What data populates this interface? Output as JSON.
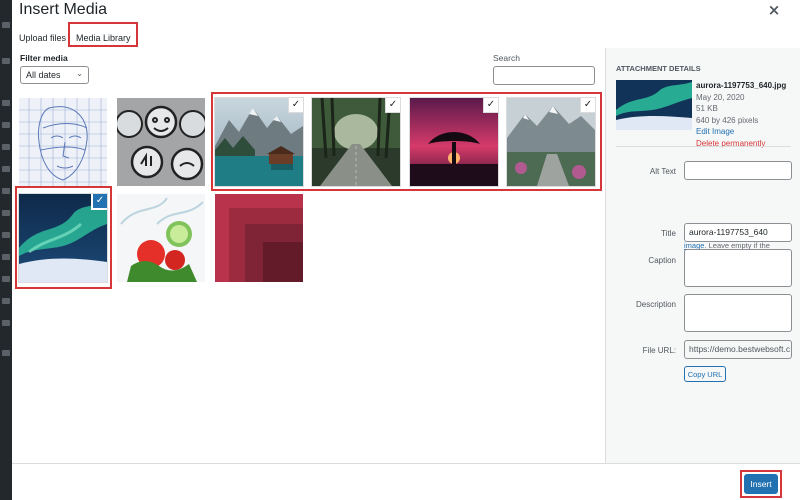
{
  "modal": {
    "title": "Insert Media",
    "close_glyph": "×",
    "tabs": [
      {
        "label": "Upload files"
      },
      {
        "label": "Media Library"
      }
    ]
  },
  "filter": {
    "label": "Filter media",
    "value": "All dates",
    "chevron_icon": "chevron-down-icon"
  },
  "search": {
    "label": "Search",
    "value": "",
    "placeholder": ""
  },
  "grid": {
    "check_glyph": "✓",
    "items": [
      {
        "name": "wireframe-face",
        "selected": false
      },
      {
        "name": "metal-face-buttons",
        "selected": false
      },
      {
        "name": "mountain-lake-cabin",
        "selected": true
      },
      {
        "name": "forest-road",
        "selected": true
      },
      {
        "name": "red-sky-tree",
        "selected": true
      },
      {
        "name": "mountain-stone-path",
        "selected": true
      },
      {
        "name": "aurora",
        "selected": true,
        "current": true
      },
      {
        "name": "vegetables-splash",
        "selected": false
      },
      {
        "name": "red-placeholder",
        "selected": false
      }
    ]
  },
  "details": {
    "heading": "Attachment Details",
    "filename": "aurora-1197753_640.jpg",
    "date": "May 20, 2020",
    "size": "51 KB",
    "dimensions": "640 by 426 pixels",
    "edit_label": "Edit Image",
    "delete_label": "Delete permanently",
    "alt_label": "Alt Text",
    "alt_value": "",
    "help_link": "Describe the purpose of the image",
    "help_text": ". Leave empty if the image is purely decorative.",
    "title_label": "Title",
    "title_value": "aurora-1197753_640",
    "caption_label": "Caption",
    "caption_value": "",
    "description_label": "Description",
    "description_value": "",
    "url_label": "File URL:",
    "url_value": "https://demo.bestwebsoft.c",
    "copy_label": "Copy URL"
  },
  "footer": {
    "insert_label": "Insert"
  },
  "colors": {
    "accent": "#2271b1",
    "highlight_red": "#d63638",
    "delete_red": "#d63638"
  }
}
